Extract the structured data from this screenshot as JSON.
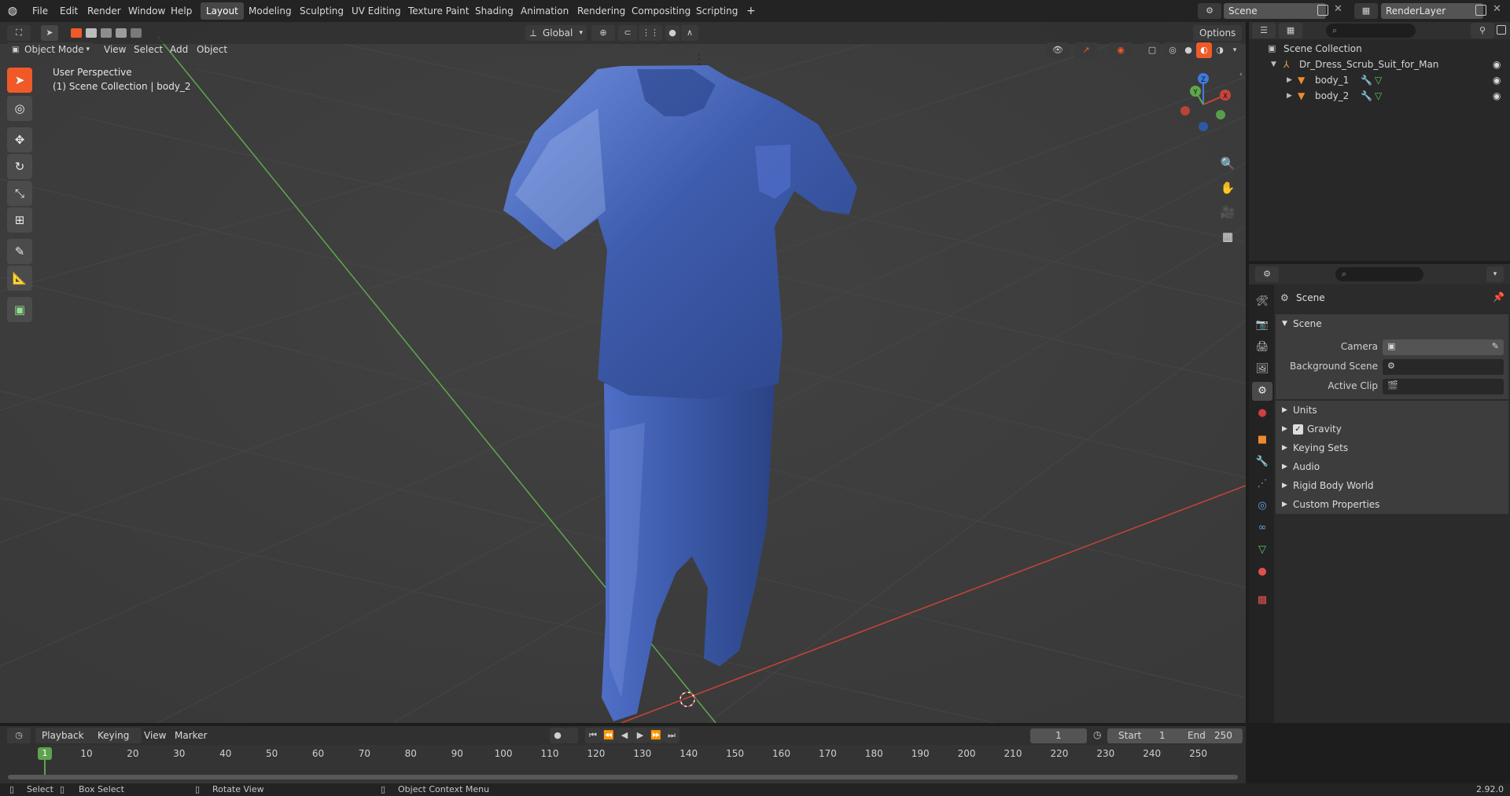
{
  "topbar": {
    "menus": [
      "File",
      "Edit",
      "Render",
      "Window",
      "Help"
    ],
    "tabs": [
      "Layout",
      "Modeling",
      "Sculpting",
      "UV Editing",
      "Texture Paint",
      "Shading",
      "Animation",
      "Rendering",
      "Compositing",
      "Scripting"
    ],
    "active_tab": "Layout",
    "add_tab": "+",
    "scene": "Scene",
    "view_layer": "RenderLayer"
  },
  "viewport_header": {
    "mode": "Object Mode",
    "menus": [
      "View",
      "Select",
      "Add",
      "Object"
    ],
    "orientation": "Global",
    "options": "Options"
  },
  "viewport": {
    "perspective": "User Perspective",
    "collection_info": "(1) Scene Collection | body_2",
    "gizmo_axes": [
      "Z",
      "Y",
      "X"
    ]
  },
  "outliner": {
    "root": "Scene Collection",
    "items": [
      {
        "name": "Dr_Dress_Scrub_Suit_for_Man"
      },
      {
        "name": "body_1"
      },
      {
        "name": "body_2"
      }
    ]
  },
  "properties": {
    "context": "Scene",
    "panel": "Scene",
    "fields": [
      {
        "label": "Camera"
      },
      {
        "label": "Background Scene"
      },
      {
        "label": "Active Clip"
      }
    ],
    "subpanels": [
      "Units",
      "Gravity",
      "Keying Sets",
      "Audio",
      "Rigid Body World",
      "Custom Properties"
    ]
  },
  "timeline": {
    "menus": [
      "Playback",
      "Keying",
      "View",
      "Marker"
    ],
    "current_frame": "1",
    "start_label": "Start",
    "start": "1",
    "end_label": "End",
    "end": "250",
    "ticks": [
      "10",
      "20",
      "30",
      "40",
      "50",
      "60",
      "70",
      "80",
      "90",
      "100",
      "110",
      "120",
      "130",
      "140",
      "150",
      "160",
      "170",
      "180",
      "190",
      "200",
      "210",
      "220",
      "230",
      "240",
      "250"
    ],
    "playhead": "1"
  },
  "statusbar": {
    "items": [
      "Select",
      "Box Select",
      "Rotate View",
      "Object Context Menu"
    ],
    "version": "2.92.0"
  },
  "colors": {
    "accent": "#f05a28",
    "x_axis": "#c8443a",
    "y_axis": "#5ea84e",
    "z_axis": "#3f7be0",
    "suit": "#3d5aa8"
  }
}
